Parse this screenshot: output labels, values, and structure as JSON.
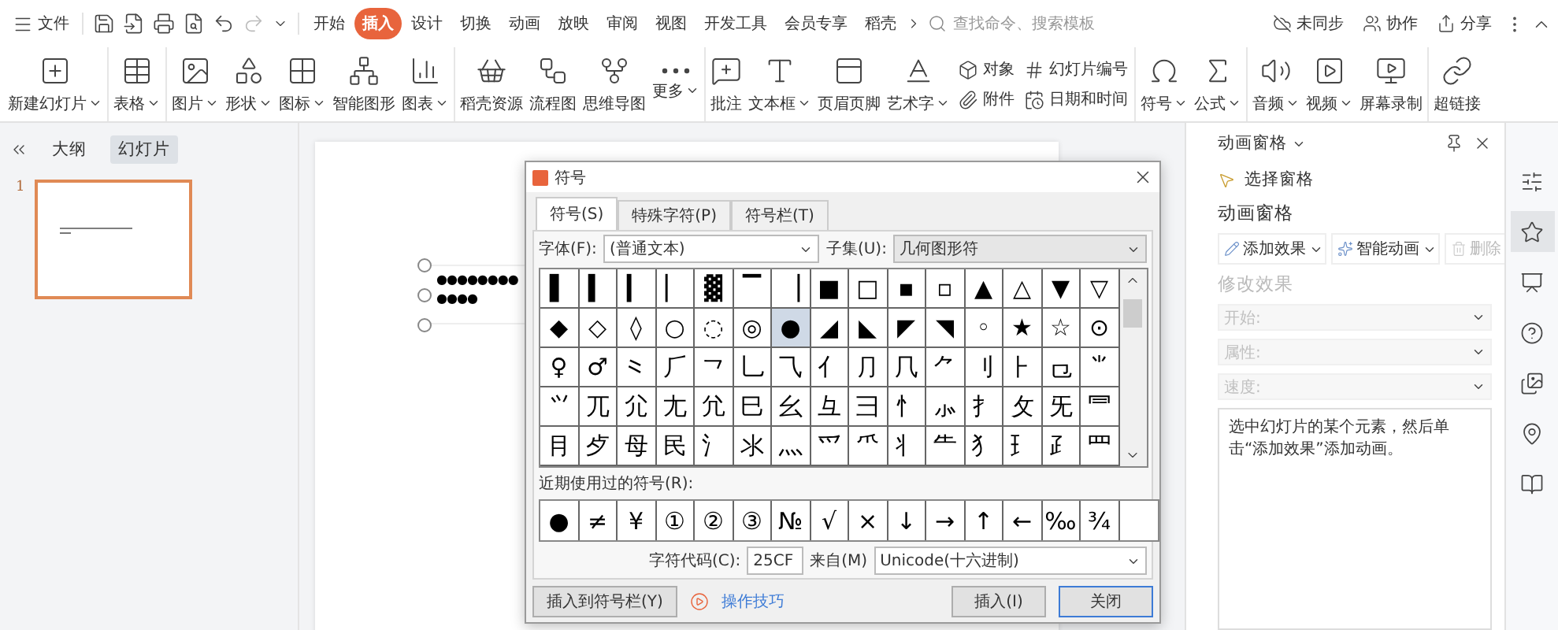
{
  "app_menu": {
    "label": "文件"
  },
  "tabs": [
    {
      "label": "开始",
      "selected": false
    },
    {
      "label": "插入",
      "selected": true
    },
    {
      "label": "设计",
      "selected": false
    },
    {
      "label": "切换",
      "selected": false
    },
    {
      "label": "动画",
      "selected": false
    },
    {
      "label": "放映",
      "selected": false
    },
    {
      "label": "审阅",
      "selected": false
    },
    {
      "label": "视图",
      "selected": false
    },
    {
      "label": "开发工具",
      "selected": false
    },
    {
      "label": "会员专享",
      "selected": false
    },
    {
      "label": "稻壳",
      "selected": false
    }
  ],
  "search": {
    "placeholder": "查找命令、搜索模板"
  },
  "header_actions": [
    {
      "label": "未同步"
    },
    {
      "label": "协作"
    },
    {
      "label": "分享"
    }
  ],
  "ribbon": {
    "groups": [
      [
        {
          "kind": "large",
          "label": "新建幻灯片",
          "dropdown": true
        }
      ],
      [
        {
          "kind": "large",
          "label": "表格",
          "dropdown": true
        }
      ],
      [
        {
          "kind": "large",
          "label": "图片",
          "dropdown": true
        },
        {
          "kind": "large",
          "label": "形状",
          "dropdown": true
        },
        {
          "kind": "large",
          "label": "图标",
          "dropdown": true
        },
        {
          "kind": "large",
          "label": "智能图形",
          "dropdown": false
        },
        {
          "kind": "large",
          "label": "图表",
          "dropdown": true
        }
      ],
      [
        {
          "kind": "large",
          "label": "稻壳资源",
          "dropdown": false
        },
        {
          "kind": "large",
          "label": "流程图",
          "dropdown": false
        },
        {
          "kind": "large",
          "label": "思维导图",
          "dropdown": false
        },
        {
          "kind": "large",
          "label": "更多",
          "dropdown": true
        }
      ],
      [
        {
          "kind": "large",
          "label": "批注",
          "dropdown": false
        },
        {
          "kind": "large",
          "label": "文本框",
          "dropdown": true
        },
        {
          "kind": "large",
          "label": "页眉页脚",
          "dropdown": false
        },
        {
          "kind": "large",
          "label": "艺术字",
          "dropdown": true
        },
        {
          "kind": "stack",
          "items": [
            {
              "label": "对象"
            },
            {
              "label": "附件"
            }
          ]
        },
        {
          "kind": "stack",
          "items": [
            {
              "label": "幻灯片编号"
            },
            {
              "label": "日期和时间"
            }
          ]
        }
      ],
      [
        {
          "kind": "large",
          "label": "符号",
          "dropdown": true
        },
        {
          "kind": "large",
          "label": "公式",
          "dropdown": true
        }
      ],
      [
        {
          "kind": "large",
          "label": "音频",
          "dropdown": true
        },
        {
          "kind": "large",
          "label": "视频",
          "dropdown": true
        },
        {
          "kind": "large",
          "label": "屏幕录制",
          "dropdown": false
        }
      ],
      [
        {
          "kind": "large",
          "label": "超链接",
          "dropdown": false
        }
      ]
    ]
  },
  "slide_panel": {
    "tabs": [
      {
        "label": "大纲",
        "selected": false
      },
      {
        "label": "幻灯片",
        "selected": true
      }
    ],
    "slides": [
      {
        "number": "1",
        "selected": true
      }
    ]
  },
  "slide": {
    "text_lines": [
      "●●●●●●●●",
      "●●●●"
    ]
  },
  "symbol_dialog": {
    "title": "符号",
    "tabs": [
      {
        "label": "符号(S)",
        "selected": true
      },
      {
        "label": "特殊字符(P)",
        "selected": false
      },
      {
        "label": "符号栏(T)",
        "selected": false
      }
    ],
    "font": {
      "label": "字体(F):",
      "value": "(普通文本)"
    },
    "subset": {
      "label": "子集(U):",
      "value": "几何图形符"
    },
    "symbols": [
      [
        {
          "char": "▌",
          "selected": false
        },
        {
          "char": "▍",
          "selected": false
        },
        {
          "char": "▎",
          "selected": false
        },
        {
          "char": "▏",
          "selected": false
        },
        {
          "char": "▓",
          "selected": false
        },
        {
          "char": "▔",
          "selected": false
        },
        {
          "char": "▕",
          "selected": false
        },
        {
          "char": "■",
          "selected": false
        },
        {
          "char": "□",
          "selected": false
        },
        {
          "char": "▪",
          "selected": false
        },
        {
          "char": "▫",
          "selected": false
        },
        {
          "char": "▲",
          "selected": false
        },
        {
          "char": "△",
          "selected": false
        },
        {
          "char": "▼",
          "selected": false
        },
        {
          "char": "▽",
          "selected": false
        }
      ],
      [
        {
          "char": "◆",
          "selected": false
        },
        {
          "char": "◇",
          "selected": false
        },
        {
          "char": "◊",
          "selected": false
        },
        {
          "char": "○",
          "selected": false
        },
        {
          "char": "◌",
          "selected": false
        },
        {
          "char": "◎",
          "selected": false
        },
        {
          "char": "●",
          "selected": true
        },
        {
          "char": "◢",
          "selected": false
        },
        {
          "char": "◣",
          "selected": false
        },
        {
          "char": "◤",
          "selected": false
        },
        {
          "char": "◥",
          "selected": false
        },
        {
          "char": "◦",
          "selected": false
        },
        {
          "char": "★",
          "selected": false
        },
        {
          "char": "☆",
          "selected": false
        },
        {
          "char": "⊙",
          "selected": false
        }
      ],
      [
        {
          "char": "♀",
          "selected": false
        },
        {
          "char": "♂",
          "selected": false
        },
        {
          "char": "⺀",
          "selected": false
        },
        {
          "char": "⺁",
          "selected": false
        },
        {
          "char": "⺂",
          "selected": false
        },
        {
          "char": "⺃",
          "selected": false
        },
        {
          "char": "⺄",
          "selected": false
        },
        {
          "char": "⺅",
          "selected": false
        },
        {
          "char": "⺆",
          "selected": false
        },
        {
          "char": "⺇",
          "selected": false
        },
        {
          "char": "⺈",
          "selected": false
        },
        {
          "char": "⺉",
          "selected": false
        },
        {
          "char": "⺊",
          "selected": false
        },
        {
          "char": "⺋",
          "selected": false
        },
        {
          "char": "⺌",
          "selected": false
        }
      ],
      [
        {
          "char": "⺍",
          "selected": false
        },
        {
          "char": "⺎",
          "selected": false
        },
        {
          "char": "⺏",
          "selected": false
        },
        {
          "char": "⺐",
          "selected": false
        },
        {
          "char": "⺑",
          "selected": false
        },
        {
          "char": "⺒",
          "selected": false
        },
        {
          "char": "⺓",
          "selected": false
        },
        {
          "char": "⺔",
          "selected": false
        },
        {
          "char": "⺕",
          "selected": false
        },
        {
          "char": "⺖",
          "selected": false
        },
        {
          "char": "⺗",
          "selected": false
        },
        {
          "char": "⺘",
          "selected": false
        },
        {
          "char": "⺙",
          "selected": false
        },
        {
          "char": "⺛",
          "selected": false
        },
        {
          "char": "⺜",
          "selected": false
        }
      ],
      [
        {
          "char": "⺝",
          "selected": false
        },
        {
          "char": "⺞",
          "selected": false
        },
        {
          "char": "⺟",
          "selected": false
        },
        {
          "char": "⺠",
          "selected": false
        },
        {
          "char": "⺡",
          "selected": false
        },
        {
          "char": "⺢",
          "selected": false
        },
        {
          "char": "⺣",
          "selected": false
        },
        {
          "char": "⺤",
          "selected": false
        },
        {
          "char": "⺥",
          "selected": false
        },
        {
          "char": "⺦",
          "selected": false
        },
        {
          "char": "⺧",
          "selected": false
        },
        {
          "char": "⺨",
          "selected": false
        },
        {
          "char": "⺩",
          "selected": false
        },
        {
          "char": "⺪",
          "selected": false
        },
        {
          "char": "⺫",
          "selected": false
        }
      ]
    ],
    "recent_label": "近期使用过的符号(R):",
    "recent": [
      "●",
      "≠",
      "¥",
      "①",
      "②",
      "③",
      "№",
      "√",
      "×",
      "↓",
      "→",
      "↑",
      "←",
      "‰",
      "¾"
    ],
    "char_code": {
      "label": "字符代码(C):",
      "value": "25CF"
    },
    "from": {
      "label": "来自(M)",
      "value": "Unicode(十六进制)"
    },
    "buttons": [
      {
        "label": "插入到符号栏(Y)",
        "kind": "button"
      },
      {
        "label": "操作技巧",
        "kind": "link"
      },
      {
        "label": "插入(I)",
        "kind": "button"
      },
      {
        "label": "关闭",
        "kind": "default"
      }
    ]
  },
  "animation_pane": {
    "title": "动画窗格",
    "selection_pane": "选择窗格",
    "heading": "动画窗格",
    "actions": [
      {
        "label": "添加效果",
        "disabled": false,
        "dropdown": true
      },
      {
        "label": "智能动画",
        "disabled": false,
        "dropdown": true
      },
      {
        "label": "删除",
        "disabled": true,
        "dropdown": false
      }
    ],
    "modify_heading": {
      "label": "修改效果",
      "disabled": true
    },
    "fields": [
      {
        "label": "开始:",
        "disabled": true
      },
      {
        "label": "属性:",
        "disabled": true
      },
      {
        "label": "速度:",
        "disabled": true
      }
    ],
    "hint": "选中幻灯片的某个元素，然后单击“添加效果”添加动画。"
  },
  "side_tools": [
    {
      "selected": false
    },
    {
      "selected": true
    },
    {
      "selected": false
    },
    {
      "selected": false
    },
    {
      "selected": false
    },
    {
      "selected": false
    },
    {
      "selected": false
    }
  ]
}
